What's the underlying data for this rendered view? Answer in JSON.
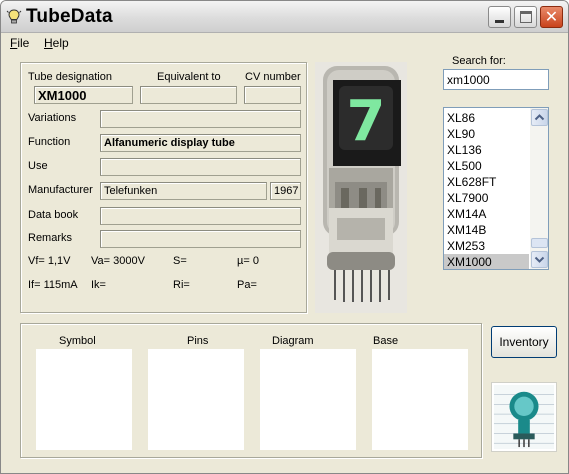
{
  "window": {
    "title": "TubeData",
    "close_glyph": "✕"
  },
  "menu": [
    {
      "accel": "F",
      "rest": "ile"
    },
    {
      "accel": "H",
      "rest": "elp"
    }
  ],
  "details": {
    "tube_designation_label": "Tube designation",
    "tube_designation_value": "XM1000",
    "equivalent_label": "Equivalent to",
    "equivalent_value": "",
    "cv_label": "CV number",
    "cv_value": "",
    "variations_label": "Variations",
    "variations_value": "",
    "function_label": "Function",
    "function_value": "Alfanumeric display tube",
    "use_label": "Use",
    "use_value": "",
    "manufacturer_label": "Manufacturer",
    "manufacturer_value": "Telefunken",
    "year_value": "1967",
    "databook_label": "Data book",
    "databook_value": "",
    "remarks_label": "Remarks",
    "remarks_value": ""
  },
  "params": {
    "vf": "Vf= 1,1V",
    "va": "Va= 3000V",
    "s": "S=",
    "mu": "µ=   0",
    "if": "If= 115mA",
    "ik": "Ik=",
    "ri": "Ri=",
    "pa": "Pa="
  },
  "tube_display_digit": "7",
  "search": {
    "label": "Search for:",
    "value": "xm1000"
  },
  "tube_list": [
    "XL86",
    "XL90",
    "XL136",
    "XL500",
    "XL628FT",
    "XL7900",
    "XM14A",
    "XM14B",
    "XM253",
    "XM1000"
  ],
  "tube_list_selected": "XM1000",
  "bottom": {
    "symbol_label": "Symbol",
    "pins_label": "Pins",
    "diagram_label": "Diagram",
    "base_label": "Base"
  },
  "inventory_label": "Inventory",
  "icons": [
    "lightbulb-icon",
    "minimize-icon",
    "maximize-icon",
    "close-icon",
    "scroll-up-icon",
    "scroll-down-icon",
    "tube-logo"
  ],
  "colors": {
    "close_button": "#c9431c",
    "input_border": "#7f9db9",
    "selected_item": "#c9c9c9",
    "tube_digit": "#7fe8a0",
    "logo_teal": "#1a8a8a"
  }
}
